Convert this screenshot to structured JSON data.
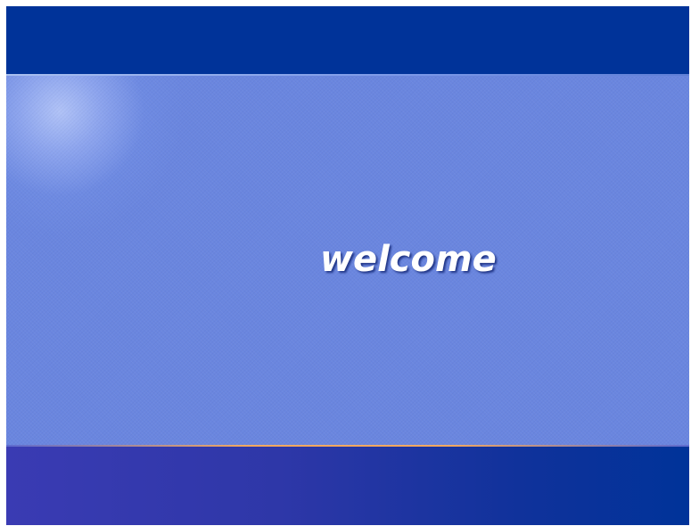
{
  "screen": {
    "welcome_text": "welcome"
  },
  "colors": {
    "top_band": "#003399",
    "panel": "#6a86df",
    "bottom_band_start": "#3a3bb3",
    "bottom_band_end": "#003399",
    "divider_accent": "#f2a860",
    "text": "#ffffff"
  }
}
